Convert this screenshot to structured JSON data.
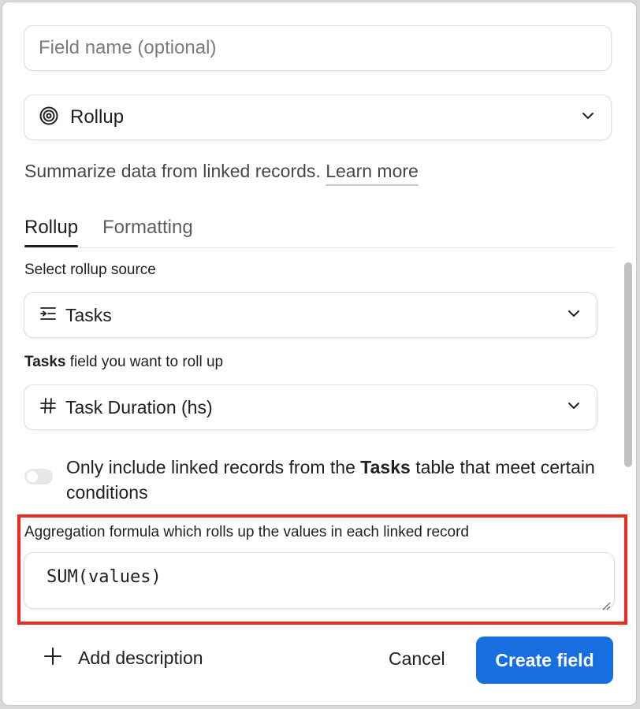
{
  "field_name": {
    "placeholder": "Field name (optional)",
    "value": ""
  },
  "field_type": {
    "label": "Rollup",
    "icon": "rollup-spiral-icon"
  },
  "description": {
    "text": "Summarize data from linked records.",
    "learn_more": "Learn more"
  },
  "tabs": [
    {
      "label": "Rollup",
      "active": true
    },
    {
      "label": "Formatting",
      "active": false
    }
  ],
  "rollup_source": {
    "section_label": "Select rollup source",
    "value": "Tasks",
    "icon": "linked-list-icon"
  },
  "rollup_field": {
    "section_label_bold": "Tasks",
    "section_label_rest": "field you want to roll up",
    "value": "Task Duration (hs)",
    "icon": "hash-icon"
  },
  "condition_toggle": {
    "text_before": "Only include linked records from the",
    "table_name": "Tasks",
    "text_after": "table that meet certain conditions",
    "on": false
  },
  "aggregation": {
    "label": "Aggregation formula which rolls up the values in each linked record",
    "formula": "SUM(values)",
    "highlight_color": "#ee2b1c"
  },
  "footer": {
    "add_description": "Add description",
    "cancel": "Cancel",
    "create": "Create field"
  },
  "colors": {
    "primary": "#166ee1",
    "text": "#1d1f25",
    "muted": "#45474d"
  }
}
